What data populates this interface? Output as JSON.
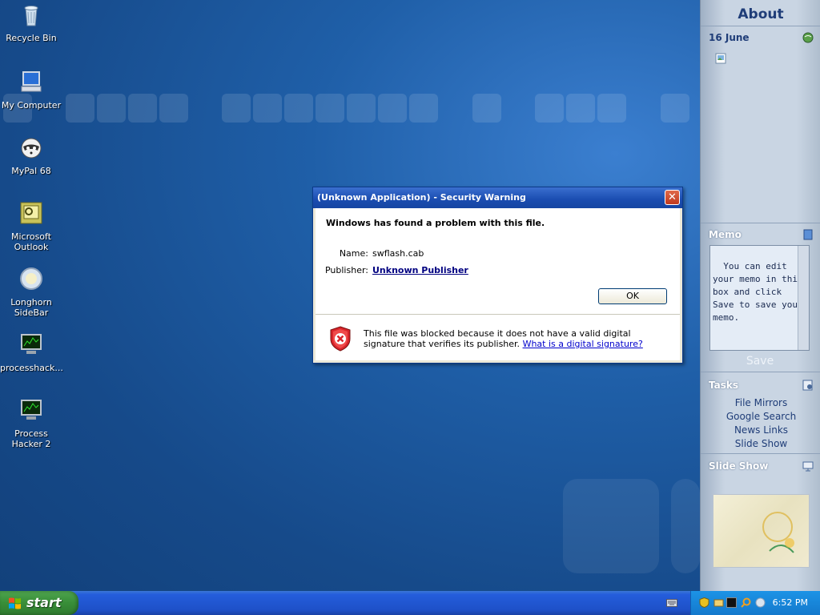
{
  "desktop": {
    "icons": [
      {
        "label": "Recycle Bin",
        "icon": "recycle-bin-icon"
      },
      {
        "label": "My Computer",
        "icon": "computer-icon"
      },
      {
        "label": "MyPal 68",
        "icon": "raccoon-icon"
      },
      {
        "label": "Microsoft Outlook",
        "icon": "outlook-icon"
      },
      {
        "label": "Longhorn SideBar",
        "icon": "sidebar-orb-icon"
      },
      {
        "label": "processhack...",
        "icon": "monitor-chart-icon"
      },
      {
        "label": "Process Hacker 2",
        "icon": "monitor-chart-icon"
      }
    ]
  },
  "sidebar": {
    "about": "About",
    "date": "16 June",
    "memo": {
      "title": "Memo",
      "text": "You can edit your memo in this box and click Save to save your memo.",
      "save": "Save"
    },
    "tasks": {
      "title": "Tasks",
      "items": [
        "File Mirrors",
        "Google Search",
        "News Links",
        "Slide Show"
      ]
    },
    "slideshow": {
      "title": "Slide Show"
    }
  },
  "dialog": {
    "title": "(Unknown Application) - Security Warning",
    "heading": "Windows has found a problem with this file.",
    "name_label": "Name:",
    "name_value": "swflash.cab",
    "publisher_label": "Publisher:",
    "publisher_value": "Unknown Publisher",
    "ok": "OK",
    "close": "✕",
    "warning_text": "This file was blocked because it does not have a valid digital signature that verifies its publisher.",
    "warning_link": "What is a digital signature?"
  },
  "taskbar": {
    "start": "start",
    "clock": "6:52 PM"
  }
}
